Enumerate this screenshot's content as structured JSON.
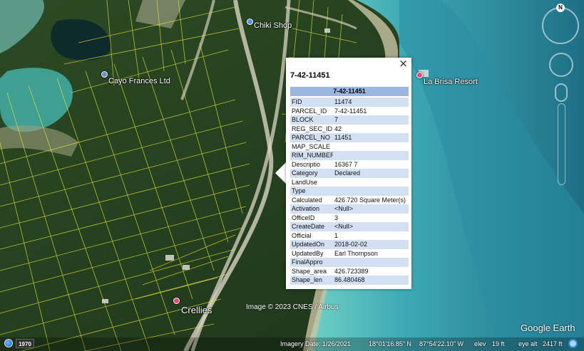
{
  "map": {
    "places": [
      {
        "name": "Chiki Shop",
        "pin_color": "#5b8fe6"
      },
      {
        "name": "Cayo Frances Ltd",
        "pin_color": "#6e8fc7"
      },
      {
        "name": "La Brisa Resort",
        "pin_color": "#e8487a"
      },
      {
        "name": "Crellies",
        "pin_color": "#e8487a"
      }
    ],
    "copyright": "Image © 2023 CNES / Airbus",
    "brand": "Google Earth"
  },
  "popup": {
    "title": "7-42-11451",
    "close_label": "×",
    "table_header": "7-42-11451",
    "attributes": [
      {
        "key": "FID",
        "value": "11474"
      },
      {
        "key": "PARCEL_ID",
        "value": "7-42-11451"
      },
      {
        "key": "BLOCK",
        "value": "7"
      },
      {
        "key": "REG_SEC_ID",
        "value": "42"
      },
      {
        "key": "PARCEL_NO",
        "value": "11451"
      },
      {
        "key": "MAP_SCALE",
        "value": ""
      },
      {
        "key": "RIM_NUMBER",
        "value": ""
      },
      {
        "key": "Descriptio",
        "value": "16367 7"
      },
      {
        "key": "Category",
        "value": "Declared"
      },
      {
        "key": "LandUse",
        "value": ""
      },
      {
        "key": "Type",
        "value": ""
      },
      {
        "key": "Calculated",
        "value": "426.720 Square Meter(s)"
      },
      {
        "key": "Activation",
        "value": "<Null>"
      },
      {
        "key": "OfficeID",
        "value": "3"
      },
      {
        "key": "CreateDate",
        "value": "<Null>"
      },
      {
        "key": "Official",
        "value": "1"
      },
      {
        "key": "UpdatedOn",
        "value": "2018-02-02"
      },
      {
        "key": "UpdatedBy",
        "value": "Earl Thompson"
      },
      {
        "key": "FinalAppro",
        "value": ""
      },
      {
        "key": "Shape_area",
        "value": "426.723389"
      },
      {
        "key": "Shape_len",
        "value": "86.480468"
      }
    ]
  },
  "navigation": {
    "compass_label": "N"
  },
  "status_bar": {
    "year": "1970",
    "imagery_date": "Imagery Date: 1/26/2021",
    "latitude": "18°01'16.85\" N",
    "longitude": "87°54'22.10\" W",
    "elev_label": "elev",
    "elev_value": "19 ft",
    "eye_alt_label": "eye alt",
    "eye_alt_value": "2417 ft"
  },
  "colors": {
    "parcel_lines": "#e8e83a",
    "sea_shallow": "#59c3c0",
    "sea_deep": "#1f6f88",
    "vegetation": "#24401f",
    "popup_header": "#9bb7df",
    "popup_row_alt": "#d3e0f3"
  }
}
